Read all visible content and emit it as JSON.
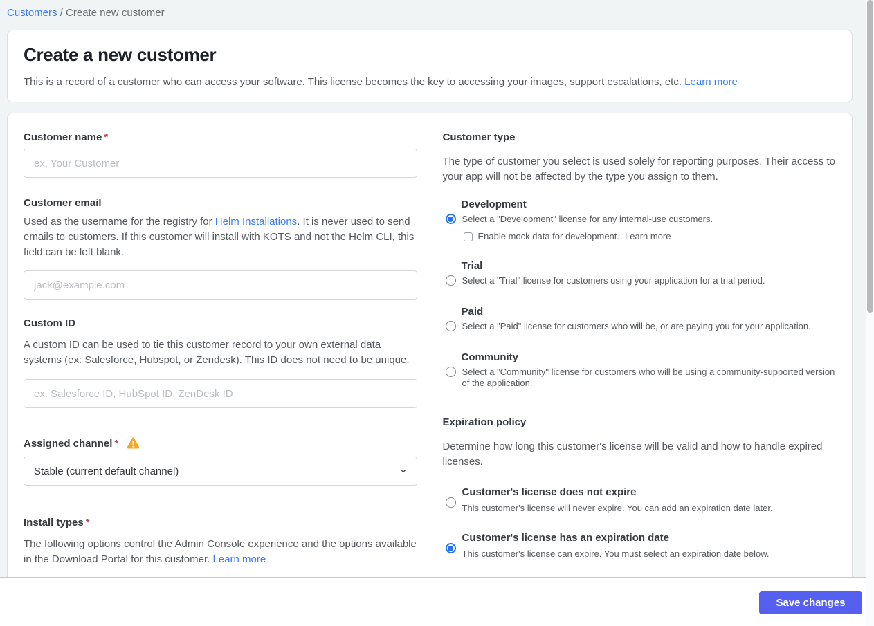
{
  "breadcrumb": {
    "link": "Customers",
    "separator": "/",
    "current": "Create new customer"
  },
  "header": {
    "title": "Create a new customer",
    "description": "This is a record of a customer who can access your software. This license becomes the key to accessing your images, support escalations, etc.",
    "learn_more": "Learn more"
  },
  "form": {
    "left": {
      "customer_name": {
        "label": "Customer name",
        "required": "*",
        "value": "",
        "placeholder": "ex. Your Customer"
      },
      "customer_email": {
        "label": "Customer email",
        "desc_before": "Used as the username for the registry for ",
        "desc_link": "Helm Installations",
        "desc_after": ". It is never used to send emails to customers. If this customer will install with KOTS and not the Helm CLI, this field can be left blank.",
        "value": "",
        "placeholder": "jack@example.com"
      },
      "custom_id": {
        "label": "Custom ID",
        "description": "A custom ID can be used to tie this customer record to your own external data systems (ex: Salesforce, Hubspot, or Zendesk). This ID does not need to be unique.",
        "value": "",
        "placeholder": "ex. Salesforce ID, HubSpot ID, ZenDesk ID"
      },
      "assigned_channel": {
        "label": "Assigned channel",
        "required": "*",
        "selected_option": "Stable (current default channel)",
        "has_warning": true
      },
      "install_types": {
        "label": "Install types",
        "required": "*",
        "description": "The following options control the Admin Console experience and the options available in the Download Portal for this customer.",
        "learn_more": "Learn more"
      }
    },
    "right": {
      "customer_type": {
        "heading": "Customer type",
        "description": "The type of customer you select is used solely for reporting purposes. Their access to your app will not be affected by the type you assign to them.",
        "options": [
          {
            "label": "Development",
            "description": "Select a \"Development\" license for any internal-use customers.",
            "selected": true
          },
          {
            "label": "Trial",
            "description": "Select a \"Trial\" license for customers using your application for a trial period.",
            "selected": false
          },
          {
            "label": "Paid",
            "description": "Select a \"Paid\" license for customers who will be, or are paying you for your application.",
            "selected": false
          },
          {
            "label": "Community",
            "description": "Select a \"Community\" license for customers who will be using a community-supported version of the application.",
            "selected": false
          }
        ],
        "mock_checkbox": {
          "label": "Enable mock data for development.",
          "learn_more": "Learn more",
          "checked": false
        }
      },
      "expiration_policy": {
        "heading": "Expiration policy",
        "description": "Determine how long this customer's license will be valid and how to handle expired licenses.",
        "options": [
          {
            "label": "Customer's license does not expire",
            "description": "This customer's license will never expire. You can add an expiration date later.",
            "selected": false
          },
          {
            "label": "Customer's license has an expiration date",
            "description": "This customer's license can expire. You must select an expiration date below.",
            "selected": true
          }
        ]
      }
    }
  },
  "footer": {
    "save_label": "Save changes"
  },
  "icons": {
    "select_chevron": "⌄",
    "assigned_channel_warning": "warning-triangle-icon"
  },
  "colors": {
    "page_background": "#f0f4f5",
    "card_background": "#ffffff",
    "card_border": "#d9dfe4",
    "link_blue": "#3b7ef2",
    "radio_blue": "#2273f0",
    "save_button": "#5560f0",
    "warning_amber": "#f6a723",
    "required_red": "#bc4b57",
    "label_text": "#363b41",
    "body_text": "#55595d",
    "placeholder_text": "#b9bec3"
  }
}
